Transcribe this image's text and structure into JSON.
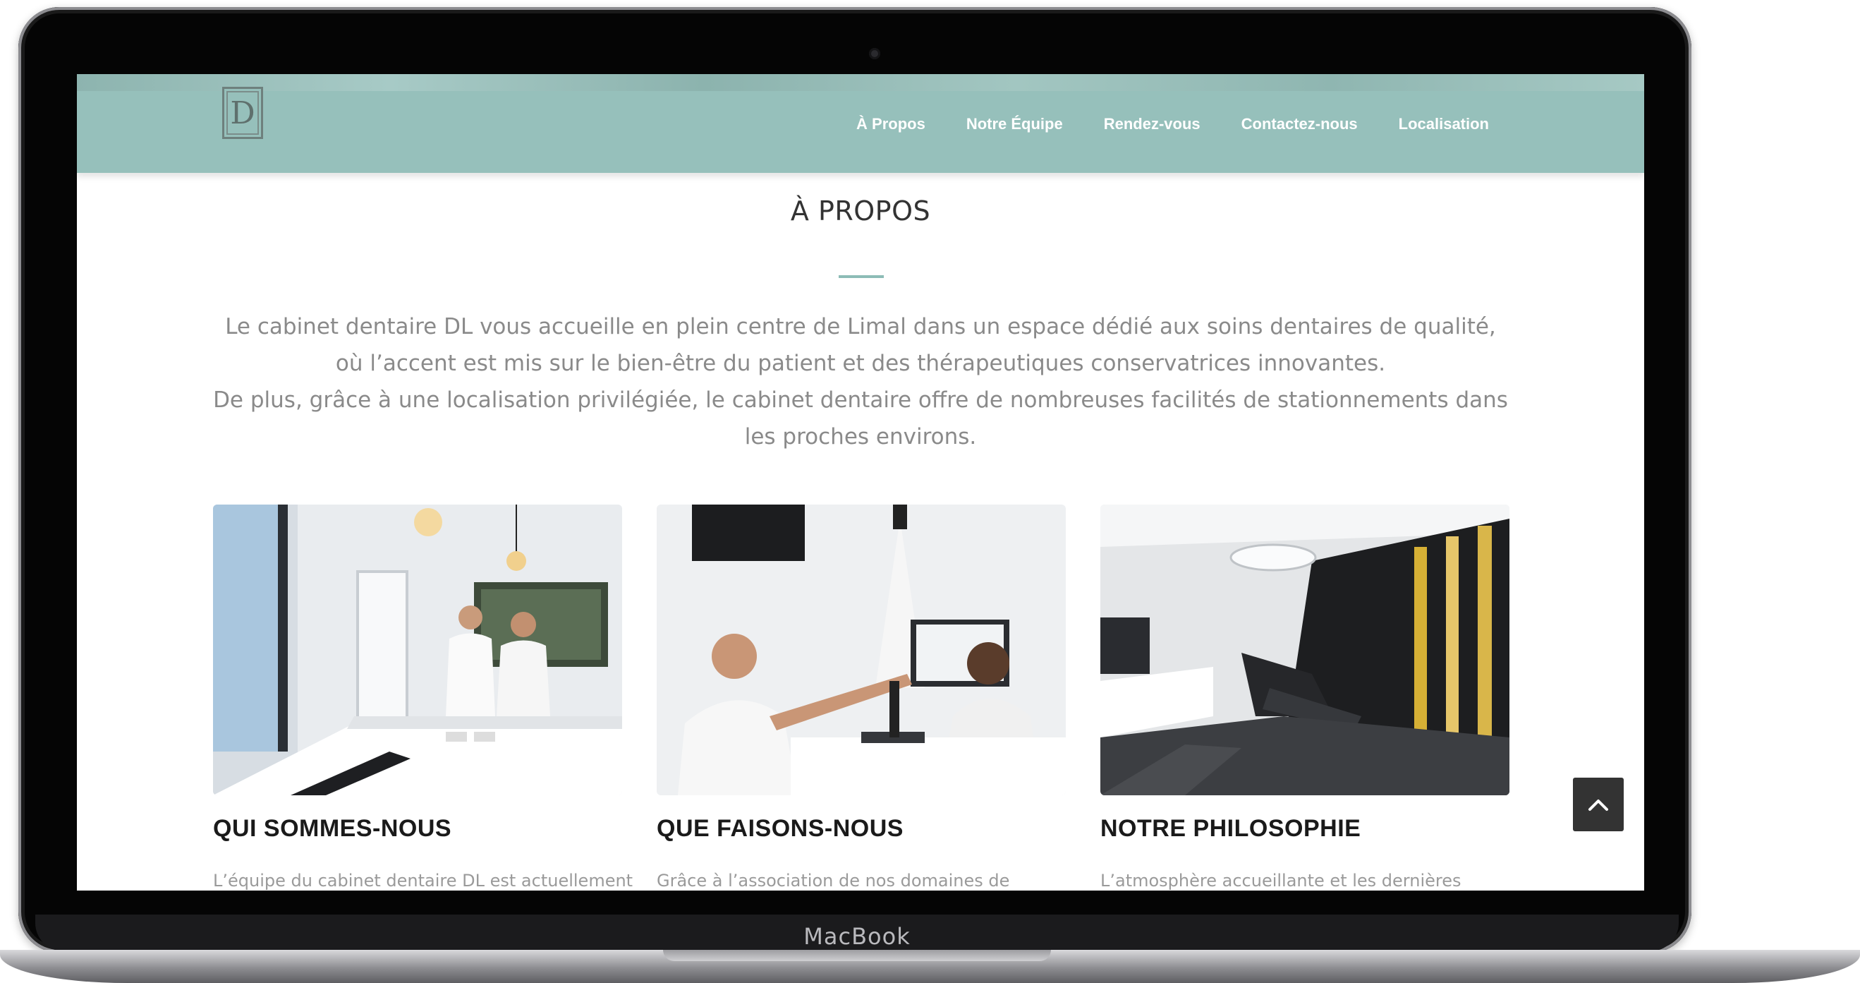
{
  "device": {
    "brand_label": "MacBook"
  },
  "site": {
    "logo_letter": "D",
    "nav": [
      {
        "label": "À Propos"
      },
      {
        "label": "Notre Équipe"
      },
      {
        "label": "Rendez-vous"
      },
      {
        "label": "Contactez-nous"
      },
      {
        "label": "Localisation"
      }
    ]
  },
  "about": {
    "title": "À PROPOS",
    "paragraph_1": "Le cabinet dentaire DL vous accueille en plein centre de Limal dans un espace dédié aux soins dentaires de qualité, où l’accent est mis sur le bien-être du patient et des thérapeutiques conservatrices innovantes.",
    "paragraph_2": "De plus, grâce à une localisation privilégiée, le cabinet dentaire offre de nombreuses facilités de stationnements dans les proches environs."
  },
  "cards": [
    {
      "title": "QUI SOMMES-NOUS",
      "excerpt": "L’équipe du cabinet dentaire DL est actuellement",
      "image": "reception-desk-two-dentists-photo"
    },
    {
      "title": "QUE FAISONS-NOUS",
      "excerpt": "Grâce à l’association de nos domaines de",
      "image": "dentist-showing-xray-to-patient-photo"
    },
    {
      "title": "NOTRE PHILOSOPHIE",
      "excerpt": "L’atmosphère accueillante et les dernières",
      "image": "treatment-room-dental-chair-photo"
    }
  ],
  "colors": {
    "navbar": "#96c0bb",
    "accent": "#8dbcb6",
    "back_to_top": "#333333"
  },
  "icons": {
    "back_to_top": "chevron-up-icon"
  }
}
